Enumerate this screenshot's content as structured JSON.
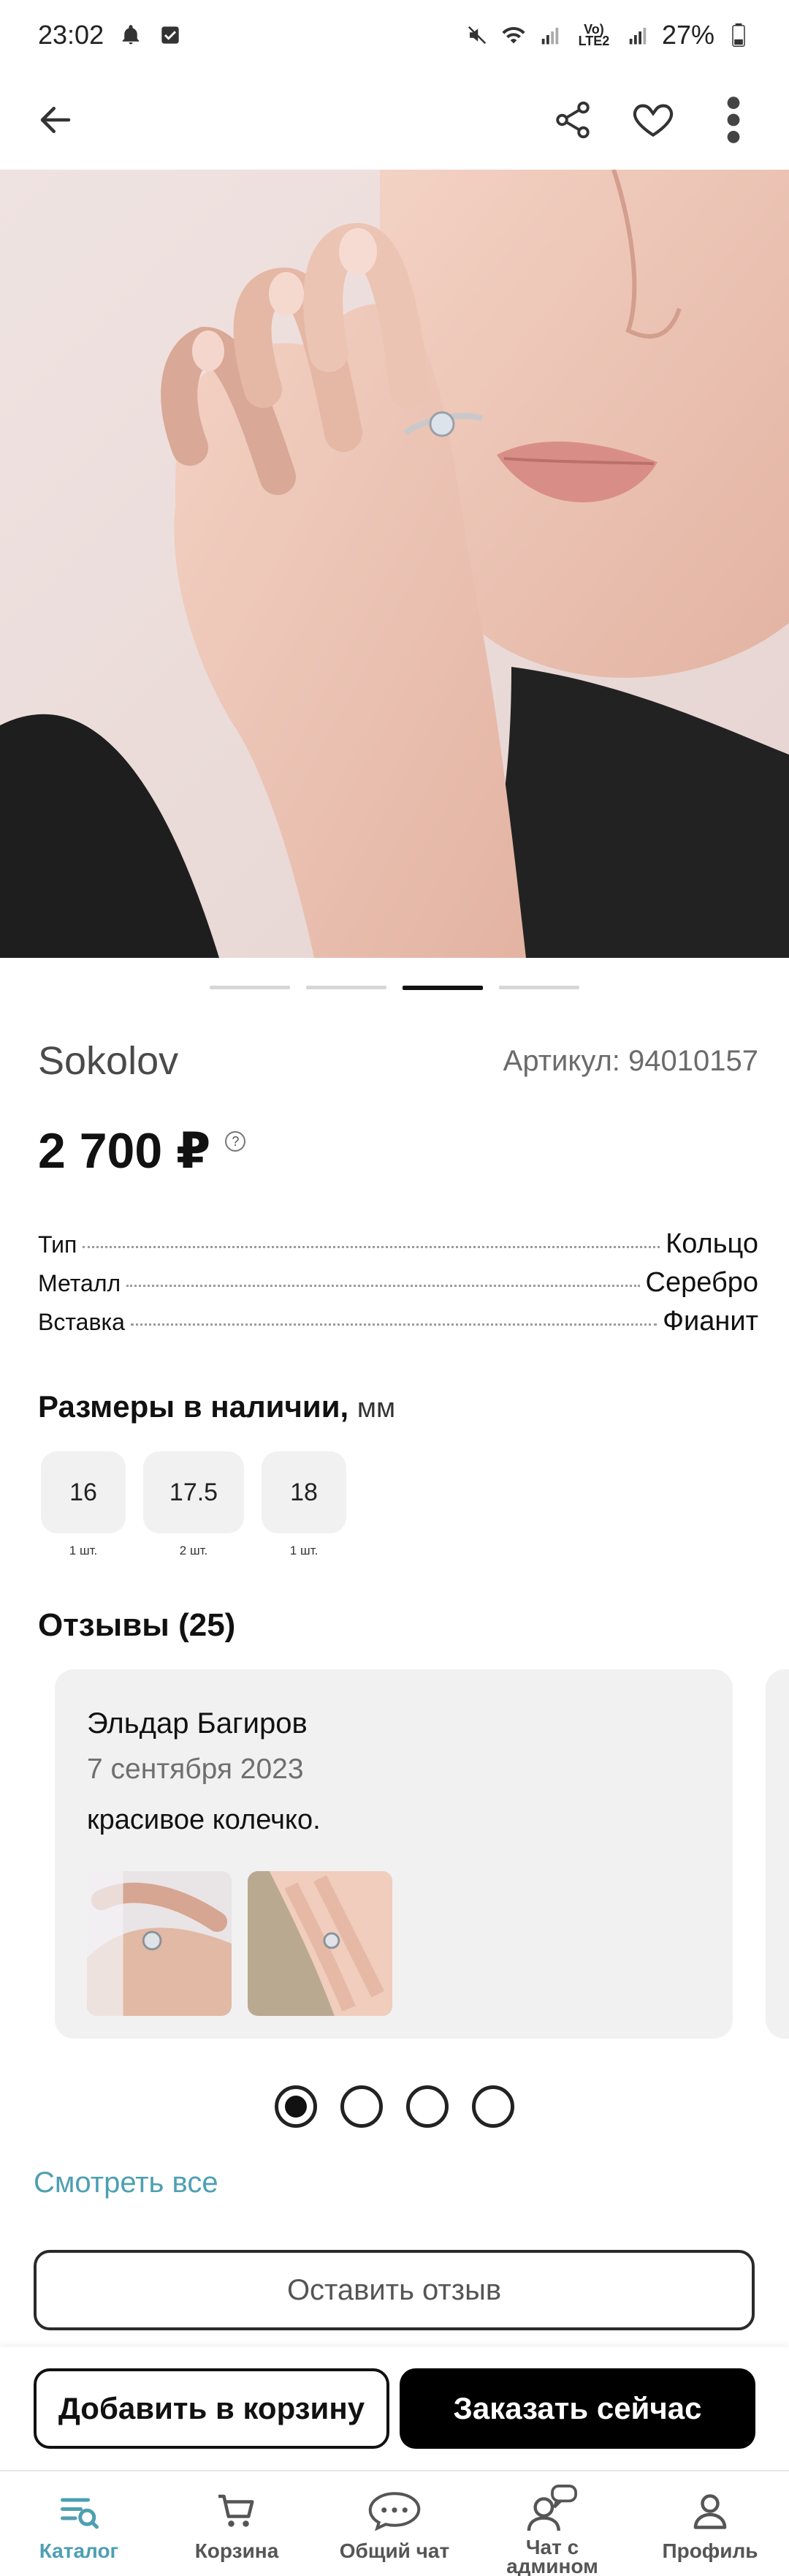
{
  "status_bar": {
    "time": "23:02",
    "network_label": "Vo) LTE2",
    "battery": "27%"
  },
  "app_bar": {
    "back_icon": "arrow-left-icon",
    "share_icon": "share-icon",
    "favorite_icon": "heart-icon",
    "more_icon": "more-vertical-icon"
  },
  "gallery": {
    "count": 4,
    "active_index": 2
  },
  "product": {
    "brand": "Sokolov",
    "article": "Артикул: 94010157",
    "price": "2 700 ₽",
    "price_help": "?"
  },
  "specs": [
    {
      "label": "Тип",
      "value": "Кольцо"
    },
    {
      "label": "Металл",
      "value": "Серебро"
    },
    {
      "label": "Вставка",
      "value": "Фианит"
    }
  ],
  "sizes": {
    "title": "Размеры в наличии,",
    "unit": "мм",
    "items": [
      {
        "size": "16",
        "qty": "1 шт."
      },
      {
        "size": "17.5",
        "qty": "2 шт."
      },
      {
        "size": "18",
        "qty": "1 шт."
      }
    ]
  },
  "reviews": {
    "title": "Отзывы (25)",
    "card": {
      "author": "Эльдар Багиров",
      "date": "7 сентября 2023",
      "text": "красивое колечко."
    },
    "pages": 4,
    "active_page": 0,
    "see_all": "Смотреть все",
    "leave_review": "Оставить отзыв"
  },
  "actions": {
    "add_to_cart": "Добавить в корзину",
    "order_now": "Заказать сейчас"
  },
  "tabs": [
    {
      "label": "Каталог",
      "icon": "catalog-search-icon",
      "active": true
    },
    {
      "label": "Корзина",
      "icon": "cart-icon",
      "active": false
    },
    {
      "label": "Общий чат",
      "icon": "chat-bubble-icon",
      "active": false
    },
    {
      "label": "Чат с админом",
      "icon": "admin-chat-icon",
      "active": false
    },
    {
      "label": "Профиль",
      "icon": "profile-icon",
      "active": false
    }
  ],
  "colors": {
    "accent": "#4e9fb2",
    "primary": "#000000",
    "card_bg": "#f1f1f1"
  }
}
